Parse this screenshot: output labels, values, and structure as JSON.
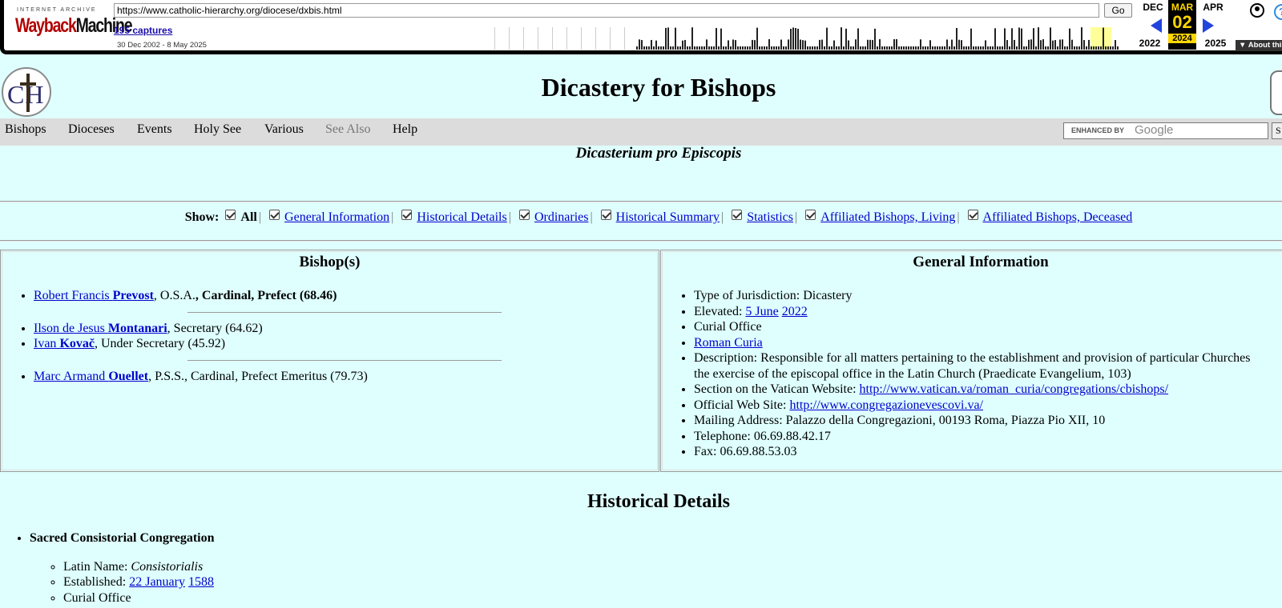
{
  "wayback": {
    "logo_top": "INTERNET ARCHIVE",
    "logo_word1": "Wayback",
    "logo_word2": "Machine",
    "url": "https://www.catholic-hierarchy.org/diocese/dxbis.html",
    "go_label": "Go",
    "captures": "195 captures",
    "range": "30 Dec 2002 - 8 May 2025",
    "prev_month": "DEC",
    "cur_month": "MAR",
    "next_month": "APR",
    "cur_day": "02",
    "prev_year": "2022",
    "cur_year": "2024",
    "next_year": "2025",
    "about": "About this capture",
    "accent": "#ffd600"
  },
  "site": {
    "logo_letters": "CH",
    "title": "Dicastery for Bishops",
    "subtitle": "Dicasterium pro Episcopis"
  },
  "nav": {
    "items": [
      "Bishops",
      "Dioceses",
      "Events",
      "Holy See",
      "Various",
      "See Also",
      "Help"
    ],
    "search_enhanced": "ENHANCED BY",
    "search_google": "Google",
    "search_button": "S"
  },
  "show": {
    "label": "Show:",
    "all": "All",
    "options": [
      "General Information",
      "Historical Details",
      "Ordinaries",
      "Historical Summary",
      "Statistics",
      "Affiliated Bishops, Living",
      "Affiliated Bishops, Deceased"
    ]
  },
  "bishops": {
    "heading": "Bishop(s)",
    "b1_first": "Robert Francis ",
    "b1_last": "Prevost",
    "b1_order": ", O.S.A.",
    "b1_role": ", Cardinal, Prefect (68.46)",
    "b2_first": "Ilson de Jesus ",
    "b2_last": "Montanari",
    "b2_role": ", Secretary (64.62)",
    "b3_first": "Ivan ",
    "b3_last": "Kovač",
    "b3_role": ", Under Secretary (45.92)",
    "b4_first": "Marc Armand ",
    "b4_last": "Ouellet",
    "b4_role": ", P.S.S., Cardinal, Prefect Emeritus (79.73)"
  },
  "general": {
    "heading": "General Information",
    "jurisdiction": "Type of Jurisdiction: Dicastery",
    "elevated_label": "Elevated: ",
    "elevated_day": "5 June",
    "elevated_year": "2022",
    "curial": "Curial Office",
    "roman_curia": "Roman Curia",
    "description": "Description: Responsible for all matters pertaining to the establishment and provision of particular Churches",
    "description_cont": "the exercise of the episcopal office in the Latin Church (Praedicate Evangelium, 103)",
    "section_label": "Section on the Vatican Website: ",
    "section_url": "http://www.vatican.va/roman_curia/congregations/cbishops/",
    "official_label": "Official Web Site: ",
    "official_url": "http://www.congregazionevescovi.va/",
    "mailing": "Mailing Address: Palazzo della Congregazioni, 00193 Roma, Piazza Pio XII, 10",
    "telephone": "Telephone: 06.69.88.42.17",
    "fax": "Fax: 06.69.88.53.03"
  },
  "historical": {
    "heading": "Historical Details",
    "item": "Sacred Consistorial Congregation",
    "latin_label": "Latin Name: ",
    "latin_value": "Consistorialis",
    "est_label": "Established: ",
    "est_day": "22 January",
    "est_year": "1588",
    "curial": "Curial Office"
  }
}
